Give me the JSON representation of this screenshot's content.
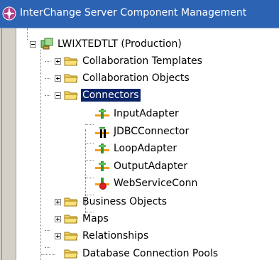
{
  "window": {
    "title": "InterChange Server Component Management"
  },
  "tree": {
    "root": {
      "label": "LWIXTEDTLT (Production)",
      "expanded": true
    },
    "items": [
      {
        "label": "Collaboration Templates",
        "type": "folder",
        "expanded": false
      },
      {
        "label": "Collaboration Objects",
        "type": "folder",
        "expanded": false
      },
      {
        "label": "Connectors",
        "type": "folder",
        "expanded": true,
        "selected": true
      },
      {
        "label": "Business Objects",
        "type": "folder",
        "expanded": false
      },
      {
        "label": "Maps",
        "type": "folder",
        "expanded": false
      },
      {
        "label": "Relationships",
        "type": "folder",
        "expanded": false
      },
      {
        "label": "Database Connection Pools",
        "type": "folder"
      }
    ],
    "connectors": [
      {
        "label": "InputAdapter",
        "icon": "adapter-icon"
      },
      {
        "label": "JDBCConnector",
        "icon": "connector-icon"
      },
      {
        "label": "LoopAdapter",
        "icon": "adapter-icon"
      },
      {
        "label": "OutputAdapter",
        "icon": "adapter-icon"
      },
      {
        "label": "WebServiceConn",
        "icon": "adapter-stopped-icon"
      }
    ]
  },
  "colors": {
    "titlebar": "#2d63b3",
    "selection": "#0a246a",
    "folder": "#f4d35a",
    "adapter_green": "#2e9a2e",
    "adapter_orange": "#f0a020",
    "status_red": "#e02020"
  }
}
